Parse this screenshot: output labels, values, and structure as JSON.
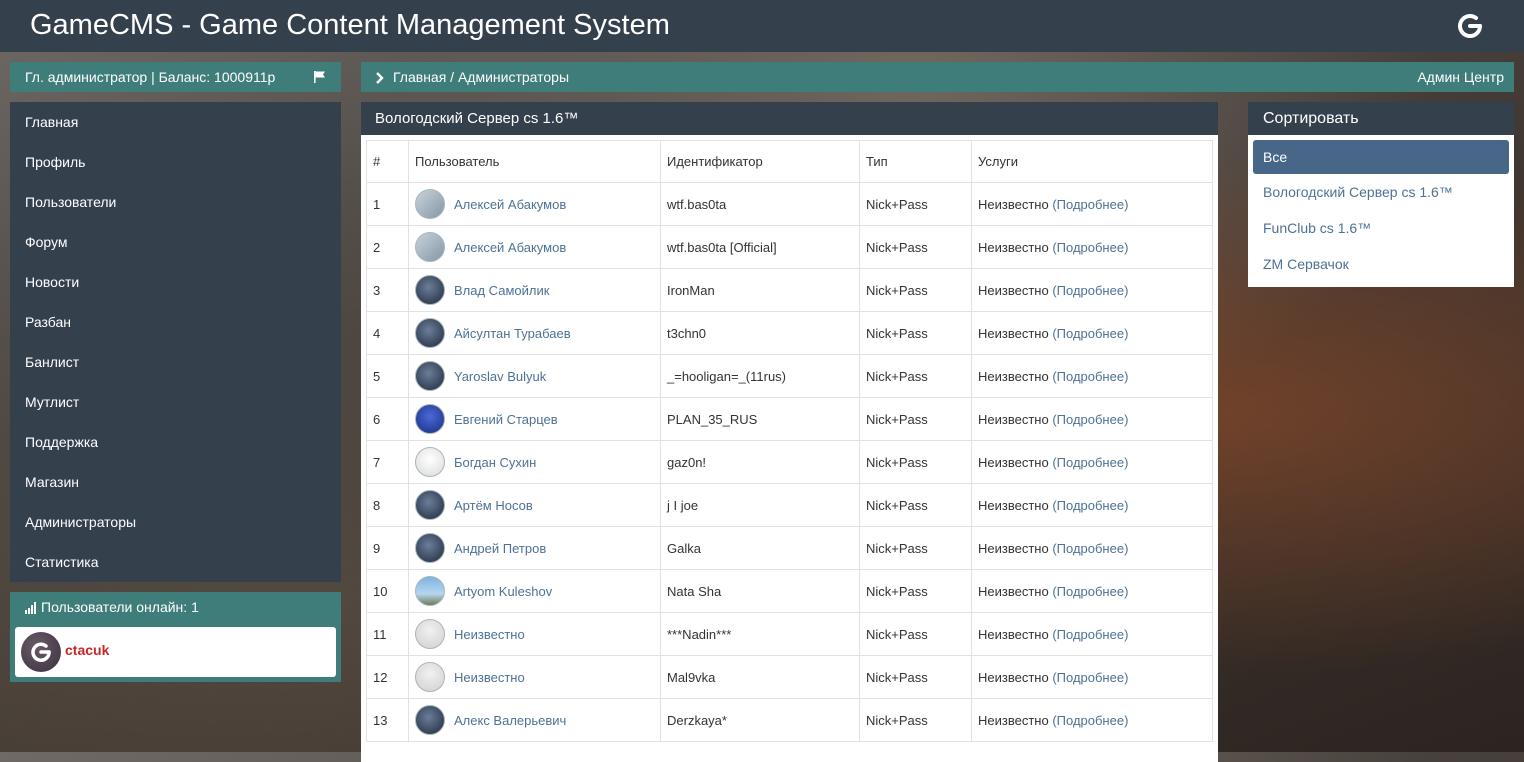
{
  "header": {
    "title": "GameCMS - Game Content Management System",
    "logo_icon": "gamecms-logo-icon"
  },
  "user_bar": {
    "text": "Гл. администратор | Баланс: 1000911р",
    "flag_icon": "flag-icon"
  },
  "sidebar": {
    "items": [
      {
        "label": "Главная"
      },
      {
        "label": "Профиль"
      },
      {
        "label": "Пользователи"
      },
      {
        "label": "Форум"
      },
      {
        "label": "Новости"
      },
      {
        "label": "Разбан"
      },
      {
        "label": "Банлист"
      },
      {
        "label": "Мутлист"
      },
      {
        "label": "Поддержка"
      },
      {
        "label": "Магазин"
      },
      {
        "label": "Администраторы"
      },
      {
        "label": "Статистика"
      }
    ]
  },
  "online": {
    "label": "Пользователи онлайн: 1",
    "user": "ctacuk"
  },
  "breadcrumb": {
    "path": "Главная / Администраторы",
    "right": "Админ Центр"
  },
  "panel": {
    "title": "Вологодский Сервер cs 1.6™",
    "columns": [
      "#",
      "Пользователь",
      "Идентификатор",
      "Тип",
      "Услуги"
    ],
    "rows": [
      {
        "num": "1",
        "user": "Алексей Абакумов",
        "id": "wtf.bas0ta",
        "type": "Nick+Pass",
        "status": "Неизвестно",
        "more": "(Подробнее)"
      },
      {
        "num": "2",
        "user": "Алексей Абакумов",
        "id": "wtf.bas0ta [Official]",
        "type": "Nick+Pass",
        "status": "Неизвестно",
        "more": "(Подробнее)"
      },
      {
        "num": "3",
        "user": "Влад Самойлик",
        "id": "IronMan",
        "type": "Nick+Pass",
        "status": "Неизвестно",
        "more": "(Подробнее)"
      },
      {
        "num": "4",
        "user": "Айсултан Турабаев",
        "id": "t3chn0",
        "type": "Nick+Pass",
        "status": "Неизвестно",
        "more": "(Подробнее)"
      },
      {
        "num": "5",
        "user": "Yaroslav Bulyuk",
        "id": "_=hooligan=_(11rus)",
        "type": "Nick+Pass",
        "status": "Неизвестно",
        "more": "(Подробнее)"
      },
      {
        "num": "6",
        "user": "Евгений Старцев",
        "id": "PLAN_35_RUS",
        "type": "Nick+Pass",
        "status": "Неизвестно",
        "more": "(Подробнее)"
      },
      {
        "num": "7",
        "user": "Богдан Сухин",
        "id": "gaz0n!",
        "type": "Nick+Pass",
        "status": "Неизвестно",
        "more": "(Подробнее)"
      },
      {
        "num": "8",
        "user": "Артём Носов",
        "id": "j I joe",
        "type": "Nick+Pass",
        "status": "Неизвестно",
        "more": "(Подробнее)"
      },
      {
        "num": "9",
        "user": "Андрей Петров",
        "id": "Galka",
        "type": "Nick+Pass",
        "status": "Неизвестно",
        "more": "(Подробнее)"
      },
      {
        "num": "10",
        "user": "Artyom Kuleshov",
        "id": "Nata Sha",
        "type": "Nick+Pass",
        "status": "Неизвестно",
        "more": "(Подробнее)"
      },
      {
        "num": "11",
        "user": "Неизвестно",
        "id": "***Nadin***",
        "type": "Nick+Pass",
        "status": "Неизвестно",
        "more": "(Подробнее)"
      },
      {
        "num": "12",
        "user": "Неизвестно",
        "id": "Mal9vka",
        "type": "Nick+Pass",
        "status": "Неизвестно",
        "more": "(Подробнее)"
      },
      {
        "num": "13",
        "user": "Алекс Валерьевич",
        "id": "Derzkaya*",
        "type": "Nick+Pass",
        "status": "Неизвестно",
        "more": "(Подробнее)"
      }
    ]
  },
  "sort": {
    "title": "Сортировать",
    "options": [
      "Все",
      "Вологодский Сервер cs 1.6™",
      "FunClub cs 1.6™",
      "ZM Сервачок"
    ]
  }
}
